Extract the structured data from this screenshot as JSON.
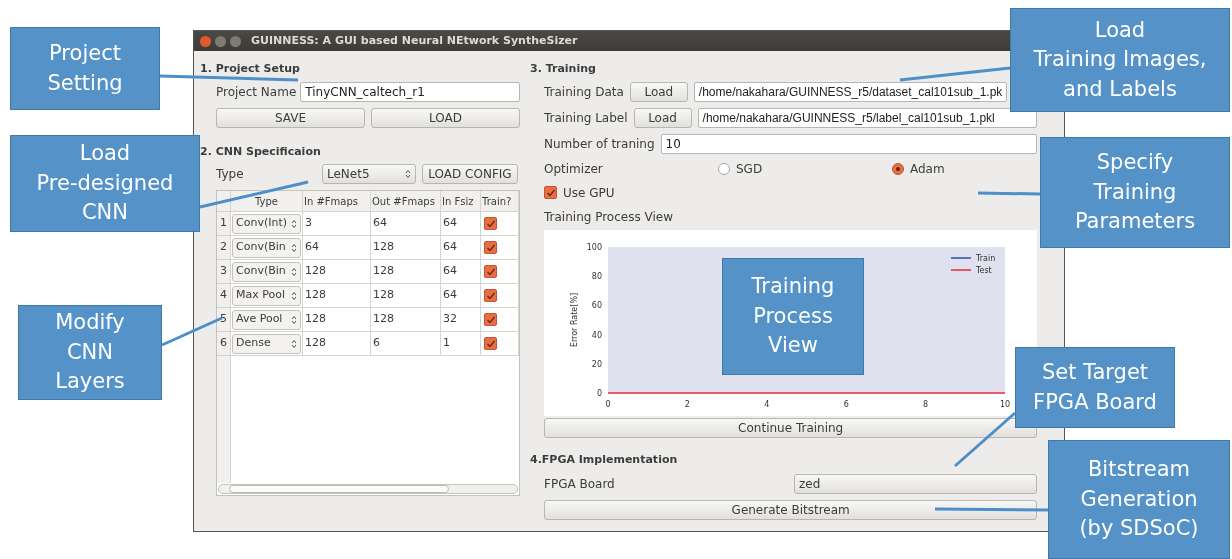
{
  "window": {
    "title": "GUINNESS: A GUI based Neural NEtwork SyntheSizer"
  },
  "project_setup": {
    "heading": "1. Project Setup",
    "name_label": "Project Name",
    "name_value": "TinyCNN_caltech_r1",
    "buttons": [
      "SAVE",
      "LOAD"
    ]
  },
  "cnn_spec": {
    "heading": "2. CNN Specificaion",
    "type_label": "Type",
    "type_value": "LeNet5",
    "load_config": "LOAD CONFIG",
    "columns": [
      "Type",
      "In #Fmaps",
      "Out #Fmaps",
      "In Fsiz",
      "Train?"
    ],
    "rows": [
      {
        "index": "1",
        "type": "Conv(Int)",
        "in_fmaps": "3",
        "out_fmaps": "64",
        "in_fsiz": "64",
        "checked": true
      },
      {
        "index": "2",
        "type": "Conv(Bin",
        "in_fmaps": "64",
        "out_fmaps": "128",
        "in_fsiz": "64",
        "checked": true
      },
      {
        "index": "3",
        "type": "Conv(Bin",
        "in_fmaps": "128",
        "out_fmaps": "128",
        "in_fsiz": "64",
        "checked": true
      },
      {
        "index": "4",
        "type": "Max Pool",
        "in_fmaps": "128",
        "out_fmaps": "128",
        "in_fsiz": "64",
        "checked": true
      },
      {
        "index": "5",
        "type": "Ave Pool",
        "in_fmaps": "128",
        "out_fmaps": "128",
        "in_fsiz": "32",
        "checked": true
      },
      {
        "index": "6",
        "type": "Dense",
        "in_fmaps": "128",
        "out_fmaps": "6",
        "in_fsiz": "1",
        "checked": true
      }
    ]
  },
  "training": {
    "heading": "3. Training",
    "data_label": "Training Data",
    "data_button": "Load",
    "data_path": "/home/nakahara/GUINNESS_r5/dataset_cal101sub_1.pk",
    "label_label": "Training Label",
    "label_button": "Load",
    "label_path": "/home/nakahara/GUINNESS_r5/label_cal101sub_1.pkl",
    "count_label": "Number of traning",
    "count_value": "10",
    "optimizer_label": "Optimizer",
    "optimizers": [
      {
        "label": "SGD",
        "selected": false
      },
      {
        "label": "Adam",
        "selected": true
      }
    ],
    "use_gpu": {
      "label": "Use GPU",
      "checked": true
    },
    "view_label": "Training Process View",
    "chart_data": {
      "type": "line",
      "legend": "upper right",
      "ylabel": "Error Rate[%]",
      "x": [
        0,
        10
      ],
      "xlim": [
        0,
        10
      ],
      "ylim": [
        0,
        100
      ],
      "xticks": [
        0,
        2,
        4,
        6,
        8,
        10
      ],
      "yticks": [
        0,
        20,
        40,
        60,
        80,
        100
      ],
      "series": [
        {
          "name": "Train",
          "color": "#2b4fb0",
          "values": [
            null,
            null
          ]
        },
        {
          "name": "Test",
          "color": "#e8283a",
          "values": [
            0,
            0
          ]
        }
      ]
    },
    "continue_button": "Continue Training"
  },
  "fpga": {
    "heading": "4.FPGA Implementation",
    "board_label": "FPGA Board",
    "board_value": "zed",
    "generate_button": "Generate Bitstream"
  },
  "callouts": [
    {
      "text": "Project\nSetting"
    },
    {
      "text": "Load\nPre-designed\nCNN"
    },
    {
      "text": "Modify\nCNN\nLayers"
    },
    {
      "text": "Load\nTraining Images,\nand Labels"
    },
    {
      "text": "Specify\nTraining\nParameters"
    },
    {
      "text": "Training\nProcess\nView"
    },
    {
      "text": "Set Target\nFPGA Board"
    },
    {
      "text": "Bitstream\nGeneration\n(by SDSoC)"
    }
  ]
}
